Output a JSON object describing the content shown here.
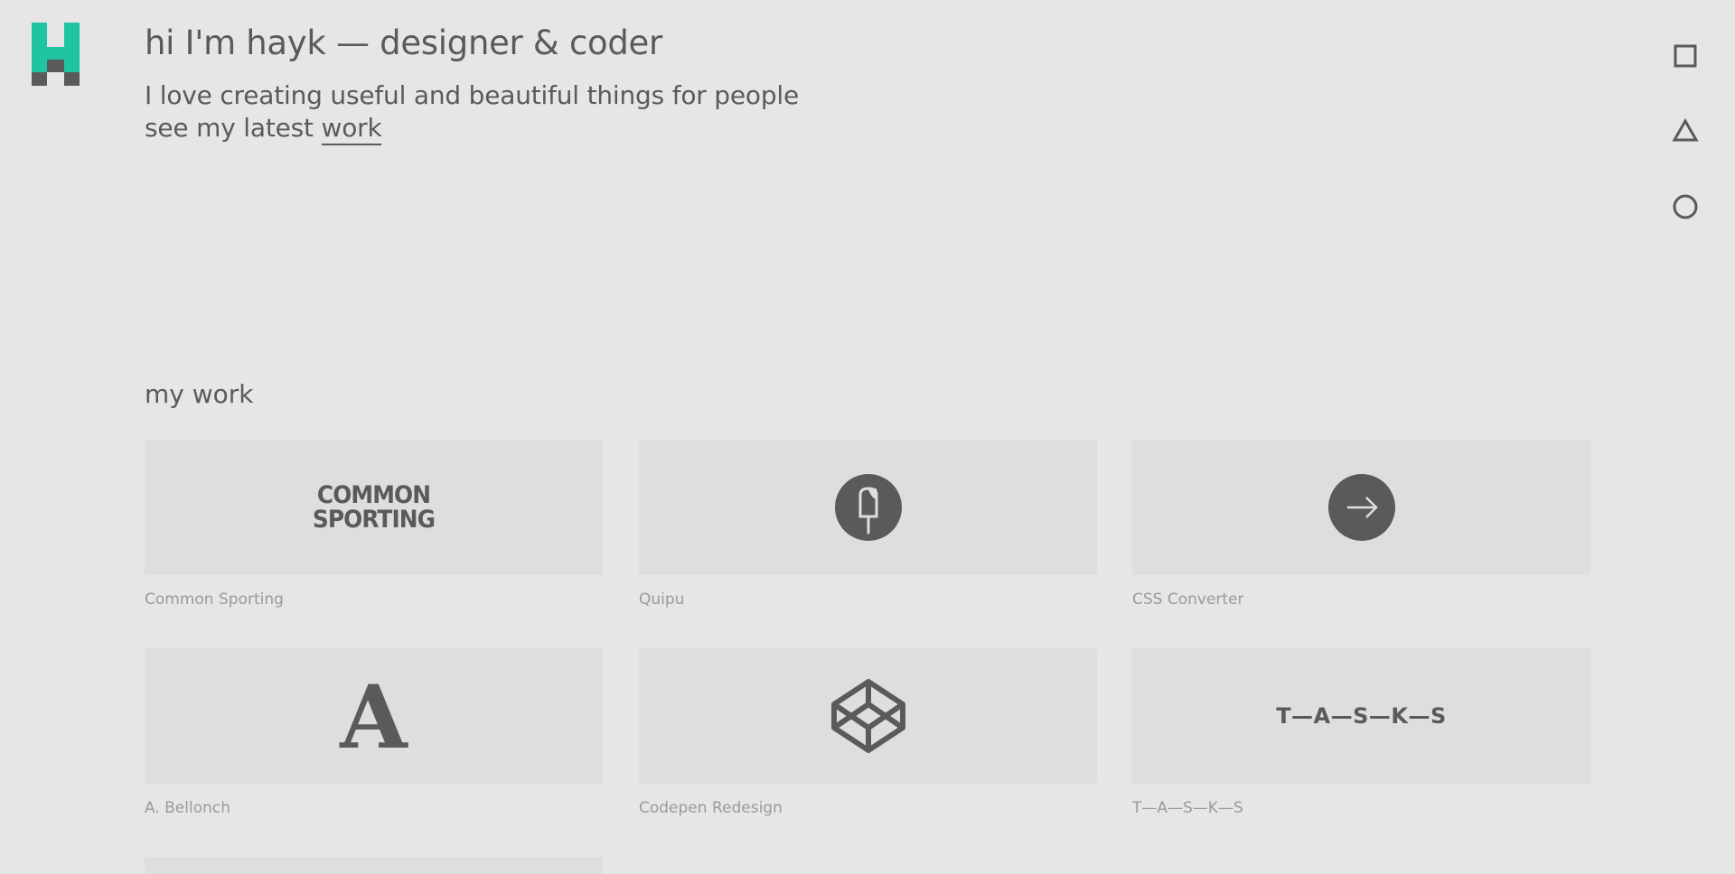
{
  "brand": {
    "accent": "#1ec5a0",
    "dark": "#5a5a5a"
  },
  "hero": {
    "title": "hi I'm hayk — designer & coder",
    "line1": "I love creating useful and beautiful things for people",
    "line2_prefix": "see my latest ",
    "line2_link": "work"
  },
  "nav": [
    {
      "icon": "square-icon"
    },
    {
      "icon": "triangle-icon"
    },
    {
      "icon": "circle-icon"
    }
  ],
  "work": {
    "title": "my work",
    "items": [
      {
        "caption": "Common Sporting",
        "logo_line1": "COMMON",
        "logo_line2": "SPORTING"
      },
      {
        "caption": "Quipu",
        "icon": "popsicle-icon"
      },
      {
        "caption": "CSS Converter",
        "icon": "arrow-right-icon"
      },
      {
        "caption": "A. Bellonch",
        "logo": "A"
      },
      {
        "caption": "Codepen Redesign",
        "icon": "codepen-icon"
      },
      {
        "caption": "T—A—S—K—S",
        "logo": "T—A—S—K—S"
      }
    ]
  }
}
